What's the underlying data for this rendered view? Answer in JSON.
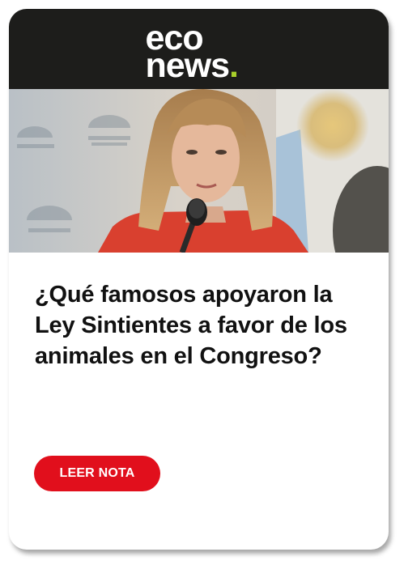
{
  "brand": {
    "logo_line1": "eco",
    "logo_line2": "news",
    "logo_dot": ".",
    "header_color": "#1d1d1b",
    "accent_color": "#a8cf2a"
  },
  "article": {
    "photo_description_icon": "article-photo",
    "headline": "¿Qué famosos apoyaron la Ley Sintientes a favor de los animales en el Congreso?"
  },
  "cta": {
    "label": "LEER NOTA",
    "color": "#e10f1c"
  }
}
